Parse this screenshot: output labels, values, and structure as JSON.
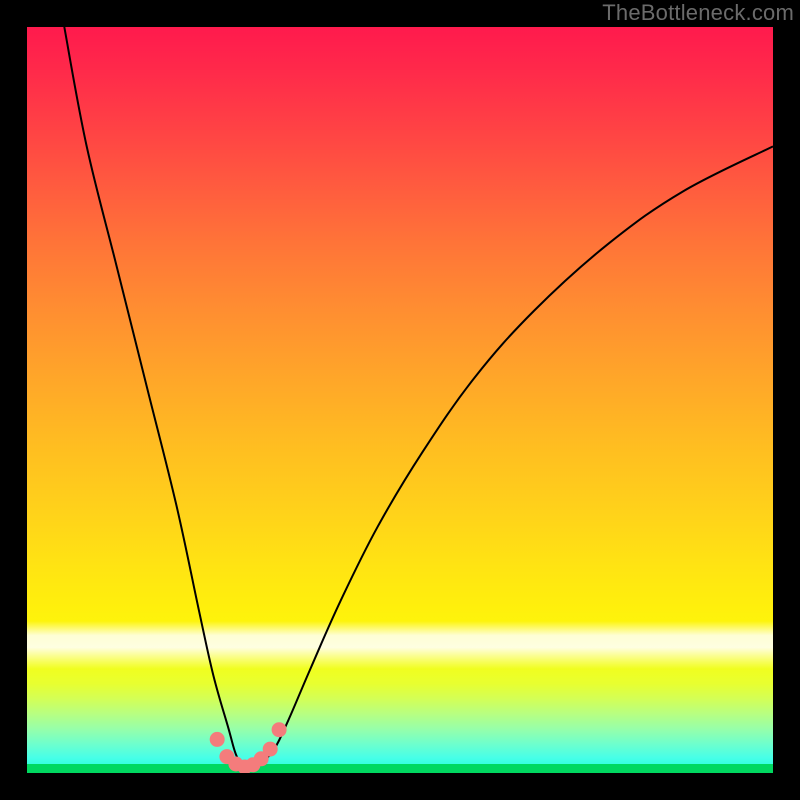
{
  "attribution": "TheBottleneck.com",
  "colors": {
    "frame": "#000000",
    "curve": "#000000",
    "dot_fill": "#f47c7c",
    "gradient_top": "#ff1a4d",
    "gradient_mid": "#ffd21a",
    "gradient_bottom": "#1fffd0",
    "deep_green": "#00d860"
  },
  "chart_data": {
    "type": "line",
    "title": "",
    "xlabel": "",
    "ylabel": "",
    "xlim": [
      0,
      100
    ],
    "ylim": [
      0,
      100
    ],
    "series": [
      {
        "name": "bottleneck-curve",
        "x": [
          5,
          8,
          12,
          16,
          20,
          23,
          25,
          27,
          28,
          29,
          30,
          31,
          33,
          35,
          38,
          42,
          47,
          53,
          60,
          68,
          78,
          88,
          100
        ],
        "y": [
          100,
          84,
          68,
          52,
          36,
          22,
          13,
          6,
          2.5,
          0.8,
          0.5,
          1,
          3,
          7,
          14,
          23,
          33,
          43,
          53,
          62,
          71,
          78,
          84
        ]
      }
    ],
    "markers": {
      "name": "trough-dots",
      "x": [
        25.5,
        26.8,
        28,
        29.2,
        30.3,
        31.4,
        32.6,
        33.8
      ],
      "y": [
        4.5,
        2.2,
        1.2,
        0.8,
        1.1,
        1.9,
        3.2,
        5.8
      ]
    }
  }
}
